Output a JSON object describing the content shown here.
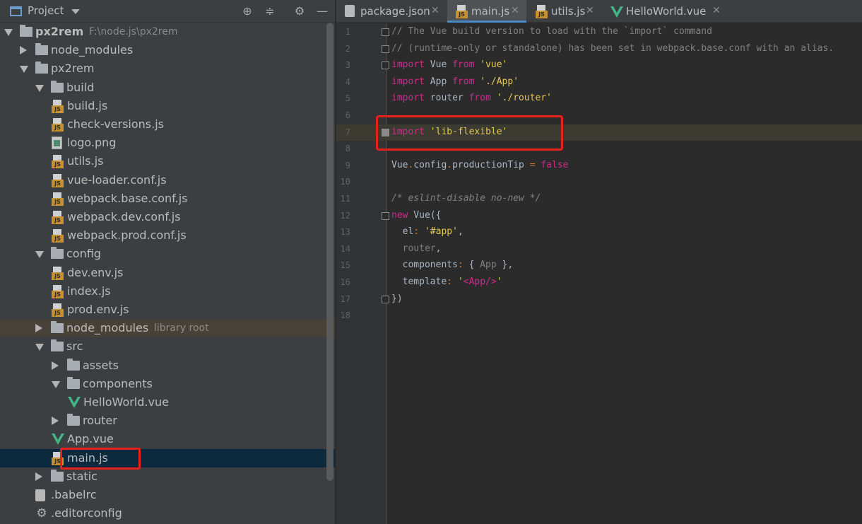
{
  "project_panel": {
    "title": "Project",
    "tree": [
      {
        "label": "px2rem",
        "sub": "F:\\node.js\\px2rem",
        "type": "folder",
        "arrow": "open",
        "depth": 0,
        "bold": true
      },
      {
        "label": "node_modules",
        "type": "folder",
        "arrow": "closed",
        "depth": 1
      },
      {
        "label": "px2rem",
        "type": "folder",
        "arrow": "open",
        "depth": 1
      },
      {
        "label": "build",
        "type": "folder",
        "arrow": "open",
        "depth": 2
      },
      {
        "label": "build.js",
        "type": "js",
        "depth": 3
      },
      {
        "label": "check-versions.js",
        "type": "js",
        "depth": 3
      },
      {
        "label": "logo.png",
        "type": "png",
        "depth": 3
      },
      {
        "label": "utils.js",
        "type": "js",
        "depth": 3
      },
      {
        "label": "vue-loader.conf.js",
        "type": "js",
        "depth": 3
      },
      {
        "label": "webpack.base.conf.js",
        "type": "js",
        "depth": 3
      },
      {
        "label": "webpack.dev.conf.js",
        "type": "js",
        "depth": 3
      },
      {
        "label": "webpack.prod.conf.js",
        "type": "js",
        "depth": 3
      },
      {
        "label": "config",
        "type": "folder",
        "arrow": "open",
        "depth": 2
      },
      {
        "label": "dev.env.js",
        "type": "js",
        "depth": 3
      },
      {
        "label": "index.js",
        "type": "js",
        "depth": 3
      },
      {
        "label": "prod.env.js",
        "type": "js",
        "depth": 3
      },
      {
        "label": "node_modules",
        "sub": "library root",
        "type": "folder",
        "arrow": "closed",
        "depth": 2,
        "lib": true
      },
      {
        "label": "src",
        "type": "folder",
        "arrow": "open",
        "depth": 2
      },
      {
        "label": "assets",
        "type": "folder",
        "arrow": "closed",
        "depth": 3
      },
      {
        "label": "components",
        "type": "folder",
        "arrow": "open",
        "depth": 3
      },
      {
        "label": "HelloWorld.vue",
        "type": "vue",
        "depth": 4
      },
      {
        "label": "router",
        "type": "folder",
        "arrow": "closed",
        "depth": 3
      },
      {
        "label": "App.vue",
        "type": "vue",
        "depth": 3
      },
      {
        "label": "main.js",
        "type": "js",
        "depth": 3,
        "selected": true
      },
      {
        "label": "static",
        "type": "folder",
        "arrow": "closed",
        "depth": 2
      },
      {
        "label": ".babelrc",
        "type": "rc",
        "depth": 2
      },
      {
        "label": ".editorconfig",
        "type": "gear",
        "depth": 2
      }
    ]
  },
  "tabs": [
    {
      "label": "package.json",
      "icon": "json-file-icon",
      "active": false
    },
    {
      "label": "main.js",
      "icon": "js-file-icon",
      "active": true
    },
    {
      "label": "utils.js",
      "icon": "js-file-icon",
      "active": false
    },
    {
      "label": "HelloWorld.vue",
      "icon": "vue-file-icon",
      "active": false
    }
  ],
  "editor": {
    "line_numbers": [
      "1",
      "2",
      "3",
      "4",
      "5",
      "6",
      "7",
      "8",
      "9",
      "10",
      "11",
      "12",
      "13",
      "14",
      "15",
      "16",
      "17",
      "18"
    ],
    "highlighted_line": "7",
    "lines": [
      [
        [
          "c",
          "// The Vue build version to load with the `import` command"
        ]
      ],
      [
        [
          "c",
          "// (runtime-only or standalone) has been set in webpack.base.conf with an alias."
        ]
      ],
      [
        [
          "kw",
          "import"
        ],
        [
          "t",
          " Vue "
        ],
        [
          "kw",
          "from"
        ],
        [
          "t",
          " "
        ],
        [
          "s",
          "'vue'"
        ]
      ],
      [
        [
          "kw",
          "import"
        ],
        [
          "t",
          " App "
        ],
        [
          "kw",
          "from"
        ],
        [
          "t",
          " "
        ],
        [
          "s",
          "'./App'"
        ]
      ],
      [
        [
          "kw",
          "import"
        ],
        [
          "t",
          " router "
        ],
        [
          "kw",
          "from"
        ],
        [
          "t",
          " "
        ],
        [
          "s",
          "'./router'"
        ]
      ],
      [],
      [
        [
          "kw",
          "import"
        ],
        [
          "t",
          " "
        ],
        [
          "s",
          "'lib-flexible'"
        ]
      ],
      [],
      [
        [
          "t",
          "Vue"
        ],
        [
          "p",
          "."
        ],
        [
          "t",
          "config"
        ],
        [
          "p",
          "."
        ],
        [
          "t",
          "productionTip "
        ],
        [
          "p",
          "="
        ],
        [
          "t",
          " "
        ],
        [
          "kw",
          "false"
        ]
      ],
      [],
      [
        [
          "ci",
          "/* eslint-disable no-new */"
        ]
      ],
      [
        [
          "kw",
          "new"
        ],
        [
          "t",
          " Vue({"
        ]
      ],
      [
        [
          "t",
          "  el"
        ],
        [
          "p",
          ":"
        ],
        [
          "t",
          " "
        ],
        [
          "s",
          "'#app'"
        ],
        [
          "t",
          ","
        ]
      ],
      [
        [
          "c",
          "  router"
        ],
        [
          "t",
          ","
        ]
      ],
      [
        [
          "t",
          "  components"
        ],
        [
          "p",
          ":"
        ],
        [
          "t",
          " { "
        ],
        [
          "c",
          "App"
        ],
        [
          "t",
          " },"
        ]
      ],
      [
        [
          "t",
          "  template"
        ],
        [
          "p",
          ":"
        ],
        [
          "t",
          " "
        ],
        [
          "s",
          "'"
        ],
        [
          "kw",
          "<App/>"
        ],
        [
          "s",
          "'"
        ]
      ],
      [
        [
          "t",
          "})"
        ]
      ],
      []
    ]
  },
  "icons": {
    "header": [
      "project-icon",
      "locate-icon",
      "collapse-icon",
      "settings-icon",
      "hide-icon"
    ]
  },
  "colors": {
    "selection_outline": "#e8221b",
    "keyword": "#cc2b8b",
    "string": "#e6c75a",
    "comment": "#808080"
  }
}
